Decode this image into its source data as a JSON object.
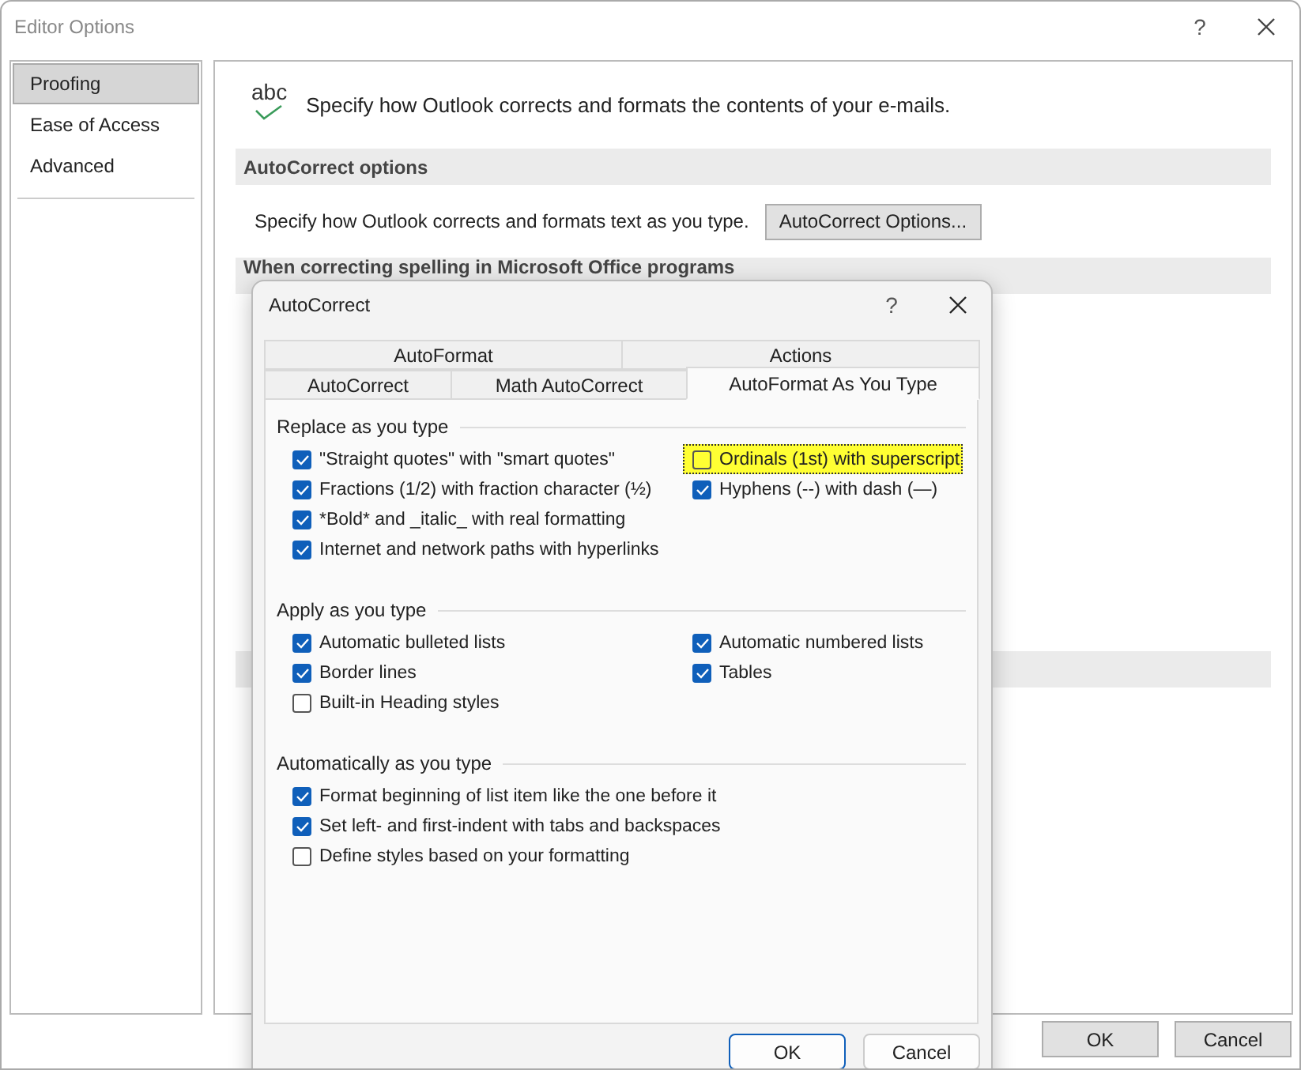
{
  "window": {
    "title": "Editor Options",
    "help": "?"
  },
  "sidebar": {
    "items": [
      {
        "label": "Proofing",
        "selected": true
      },
      {
        "label": "Ease of Access",
        "selected": false
      },
      {
        "label": "Advanced",
        "selected": false
      }
    ]
  },
  "header": {
    "text": "Specify how Outlook corrects and formats the contents of your e-mails.",
    "icon_text": "abc"
  },
  "sections": [
    {
      "kind": "options",
      "title": "AutoCorrect options",
      "description": "Specify how Outlook corrects and formats text as you type.",
      "button": "AutoCorrect Options..."
    },
    {
      "kind": "header",
      "title": "When correcting spelling in Microsoft Office programs"
    },
    {
      "kind": "header"
    }
  ],
  "buttons": [
    "OK",
    "Cancel"
  ],
  "dialog": {
    "title": "AutoCorrect",
    "help": "?",
    "tab_rows": [
      [
        {
          "label": "AutoFormat",
          "selected": false
        },
        {
          "label": "Actions",
          "selected": false
        }
      ],
      [
        {
          "label": "AutoCorrect",
          "selected": false
        },
        {
          "label": "Math AutoCorrect",
          "selected": false
        },
        {
          "label": "AutoFormat As You Type",
          "selected": true
        }
      ]
    ],
    "groups": [
      {
        "title": "Replace as you type",
        "columns": [
          [
            {
              "label": "\"Straight quotes\" with \"smart quotes\"",
              "checked": true,
              "highlighted": false
            },
            {
              "label": "Fractions (1/2) with fraction character (½)",
              "checked": true,
              "highlighted": false
            },
            {
              "label": "*Bold* and _italic_ with real formatting",
              "checked": true,
              "highlighted": false
            },
            {
              "label": "Internet and network paths with hyperlinks",
              "checked": true,
              "highlighted": false
            }
          ],
          [
            {
              "label": "Ordinals (1st) with superscript",
              "checked": false,
              "highlighted": true
            },
            {
              "label": "Hyphens (--) with dash (—)",
              "checked": true,
              "highlighted": false
            }
          ]
        ]
      },
      {
        "title": "Apply as you type",
        "columns": [
          [
            {
              "label": "Automatic bulleted lists",
              "checked": true,
              "highlighted": false
            },
            {
              "label": "Border lines",
              "checked": true,
              "highlighted": false
            },
            {
              "label": "Built-in Heading styles",
              "checked": false,
              "highlighted": false
            }
          ],
          [
            {
              "label": "Automatic numbered lists",
              "checked": true,
              "highlighted": false
            },
            {
              "label": "Tables",
              "checked": true,
              "highlighted": false
            }
          ]
        ]
      },
      {
        "title": "Automatically as you type",
        "columns": [
          [
            {
              "label": "Format beginning of list item like the one before it",
              "checked": true,
              "highlighted": false
            },
            {
              "label": "Set left- and first-indent with tabs and backspaces",
              "checked": true,
              "highlighted": false
            },
            {
              "label": "Define styles based on your formatting",
              "checked": false,
              "highlighted": false
            }
          ]
        ]
      }
    ],
    "buttons": [
      "OK",
      "Cancel"
    ]
  }
}
